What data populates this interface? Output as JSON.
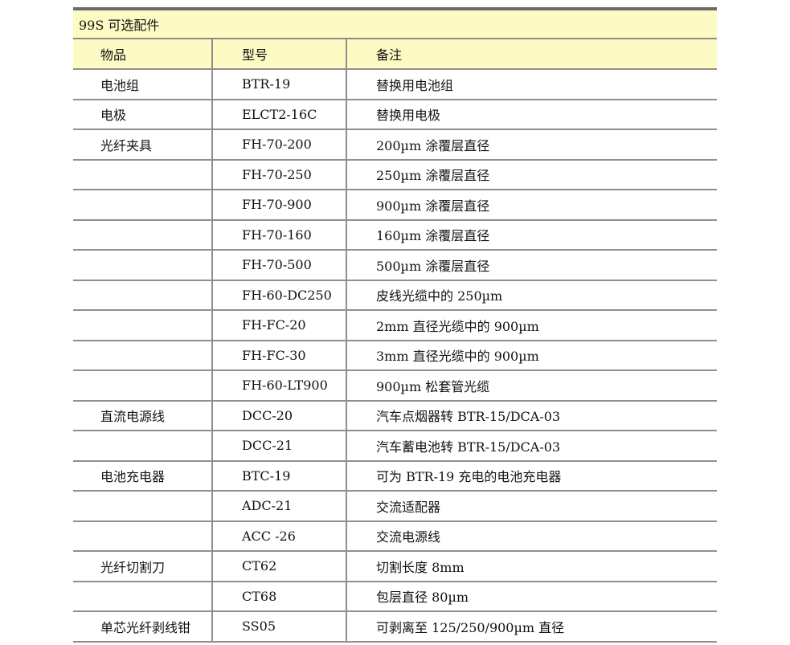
{
  "table": {
    "title": "99S 可选配件",
    "headers": [
      "物品",
      "型号",
      "备注"
    ],
    "rows": [
      [
        "电池组",
        "BTR-19",
        "替换用电池组"
      ],
      [
        "电极",
        "ELCT2-16C",
        "替换用电极"
      ],
      [
        "光纤夹具",
        "FH-70-200",
        "200µm  涂覆层直径"
      ],
      [
        "",
        "FH-70-250",
        "250µm  涂覆层直径"
      ],
      [
        "",
        "FH-70-900",
        "900µm  涂覆层直径"
      ],
      [
        "",
        "FH-70-160",
        "160µm  涂覆层直径"
      ],
      [
        "",
        "FH-70-500",
        "500µm  涂覆层直径"
      ],
      [
        "",
        "FH-60-DC250",
        "皮线光缆中的  250µm"
      ],
      [
        "",
        "FH-FC-20",
        "2mm  直径光缆中的  900µm"
      ],
      [
        "",
        "FH-FC-30",
        "3mm  直径光缆中的  900µm"
      ],
      [
        "",
        "FH-60-LT900",
        "900µm  松套管光缆"
      ],
      [
        "直流电源线",
        "DCC-20",
        "汽车点烟器转  BTR-15/DCA-03"
      ],
      [
        "",
        "DCC-21",
        "汽车蓄电池转  BTR-15/DCA-03"
      ],
      [
        "电池充电器",
        "BTC-19",
        "可为  BTR-19  充电的电池充电器"
      ],
      [
        "",
        "ADC-21",
        "交流适配器"
      ],
      [
        "",
        "ACC -26",
        "交流电源线"
      ],
      [
        "光纤切割刀",
        "CT62",
        "切割长度  8mm"
      ],
      [
        "",
        "CT68",
        "包层直径  80µm"
      ],
      [
        "单芯光纤剥线钳",
        "SS05",
        "可剥离至  125/250/900µm  直径"
      ]
    ]
  },
  "colors": {
    "header_bg": "#fdfbc3",
    "rule": "#8f8f8f",
    "top_rule": "#6a6a6a"
  }
}
